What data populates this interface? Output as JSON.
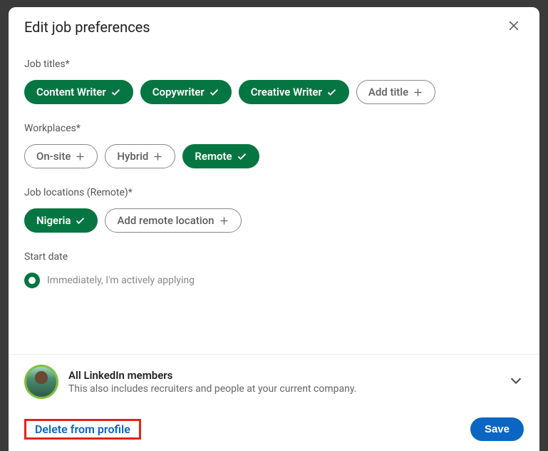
{
  "modal": {
    "title": "Edit job preferences",
    "sections": {
      "jobTitles": {
        "label": "Job titles*",
        "chips": [
          "Content Writer",
          "Copywriter",
          "Creative Writer"
        ],
        "add": "Add title"
      },
      "workplaces": {
        "label": "Workplaces*",
        "outline": [
          "On-site",
          "Hybrid"
        ],
        "selected": [
          "Remote"
        ]
      },
      "locations": {
        "label": "Job locations (Remote)*",
        "selected": [
          "Nigeria"
        ],
        "add": "Add remote location"
      },
      "startDate": {
        "label": "Start date",
        "option": "Immediately, I'm actively applying"
      }
    },
    "visibility": {
      "title": "All LinkedIn members",
      "sub": "This also includes recruiters and people at your current company."
    },
    "footer": {
      "delete": "Delete from profile",
      "save": "Save"
    }
  }
}
